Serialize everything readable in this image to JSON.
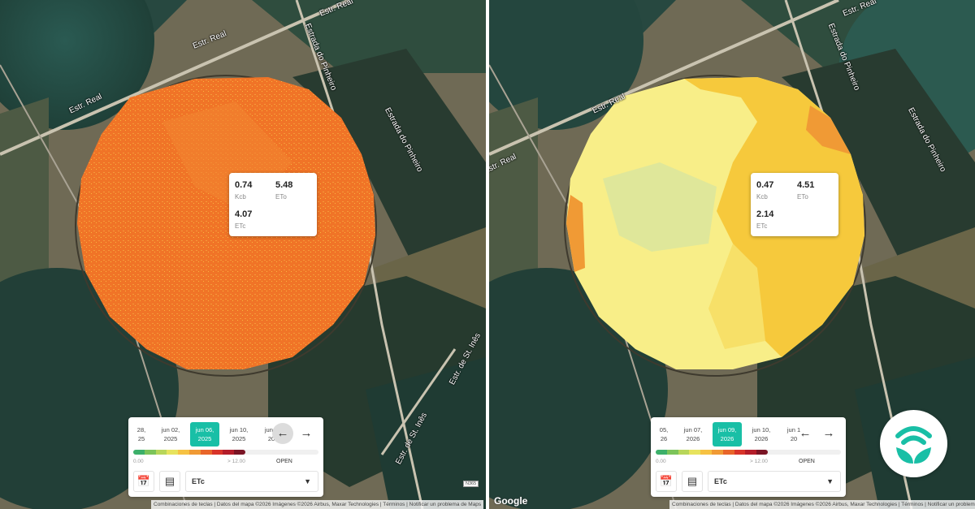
{
  "left": {
    "info": {
      "kcb_value": "0.74",
      "kcb_label": "Kcb",
      "eto_value": "5.48",
      "eto_label": "ETo",
      "etc_value": "4.07",
      "etc_label": "ETc"
    },
    "dates": [
      {
        "line1": "28,",
        "line2": "25",
        "selected": false
      },
      {
        "line1": "jun 02,",
        "line2": "2025",
        "selected": false
      },
      {
        "line1": "jun 06,",
        "line2": "2025",
        "selected": true
      },
      {
        "line1": "jun 10,",
        "line2": "2025",
        "selected": false
      },
      {
        "line1": "jun 1",
        "line2": "20",
        "selected": false
      }
    ],
    "scale_min": "0.00",
    "scale_max": "> 12.00",
    "open_label": "OPEN",
    "select_value": "ETc",
    "nav_prev": "←",
    "nav_next": "→",
    "attribution": "Combinaciones de teclas  |  Datos del mapa ©2026 Imágenes ©2026 Airbus, Maxar Technologies  |  Términos  |  Notificar un problema de Maps",
    "field_color": "#f07427"
  },
  "right": {
    "info": {
      "kcb_value": "0.47",
      "kcb_label": "Kcb",
      "eto_value": "4.51",
      "eto_label": "ETo",
      "etc_value": "2.14",
      "etc_label": "ETc"
    },
    "dates": [
      {
        "line1": "05,",
        "line2": "26",
        "selected": false
      },
      {
        "line1": "jun 07,",
        "line2": "2026",
        "selected": false
      },
      {
        "line1": "jun 09,",
        "line2": "2026",
        "selected": true
      },
      {
        "line1": "jun 10,",
        "line2": "2026",
        "selected": false
      },
      {
        "line1": "jun 1",
        "line2": "20",
        "selected": false
      }
    ],
    "scale_min": "0.00",
    "scale_max": "> 12.00",
    "open_label": "OPEN",
    "select_value": "ETc",
    "nav_prev": "←",
    "nav_next": "→",
    "attribution": "Combinaciones de teclas  |  Datos del mapa ©2026 Imágenes ©2026 Airbus, Maxar Technologies  |  Términos  |  Notificar un problema de Maps",
    "google_logo": "Google",
    "field_color": "#f8e86a"
  },
  "road_labels": {
    "estr_real": "Estr. Real",
    "estrada_pinheiro": "Estrada do Pinheiro",
    "estrada_st_ines": "Estr. de St. Inês",
    "n365": "N365"
  },
  "scale_colors": [
    "#3cb06a",
    "#7cc45a",
    "#b8d65a",
    "#e7e35e",
    "#f6c243",
    "#f09a35",
    "#e8652a",
    "#d8342a",
    "#b41d2a",
    "#7a1525"
  ],
  "icons": {
    "calendar": "calendar-icon",
    "ruler": "ruler-icon",
    "chevron": "chevron-down-icon",
    "brand": "brand-leaf-icon"
  }
}
